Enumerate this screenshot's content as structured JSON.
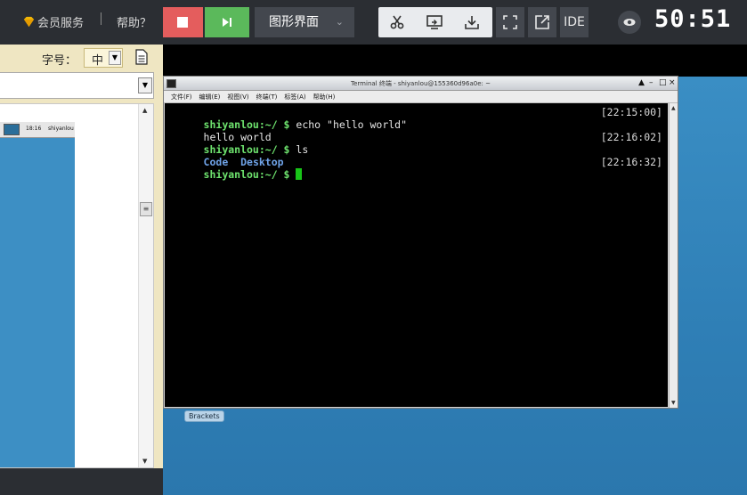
{
  "topbar": {
    "member_label": "会员服务",
    "separator": "|",
    "help_label": "帮助？",
    "mode_label": "图形界面",
    "ide_label": "IDE",
    "timer": "50:51",
    "colors": {
      "stop": "#e45d5d",
      "play": "#5bb95b",
      "dark": "#2b2e33"
    }
  },
  "left_panel": {
    "font_size_label": "字号：",
    "font_size_value": "中",
    "thumbnail": {
      "clock": "18:16",
      "user": "shiyanlou"
    }
  },
  "terminal": {
    "title": "Terminal 终端 - shiyanlou@155360d96a0e: ~",
    "menu": [
      "文件(F)",
      "编辑(E)",
      "视图(V)",
      "终端(T)",
      "标签(A)",
      "帮助(H)"
    ],
    "prompt": "shiyanlou:~/ $",
    "lines": [
      {
        "cmd": " echo \"hello world\"",
        "time": "[22:15:00]"
      },
      {
        "output": "hello world"
      },
      {
        "cmd": " ls",
        "time": "[22:16:02]"
      },
      {
        "dirs": [
          "Code",
          "Desktop"
        ]
      },
      {
        "cmd": " ",
        "time": "[22:16:32]"
      }
    ]
  },
  "desktop": {
    "icon_label": "Brackets"
  }
}
